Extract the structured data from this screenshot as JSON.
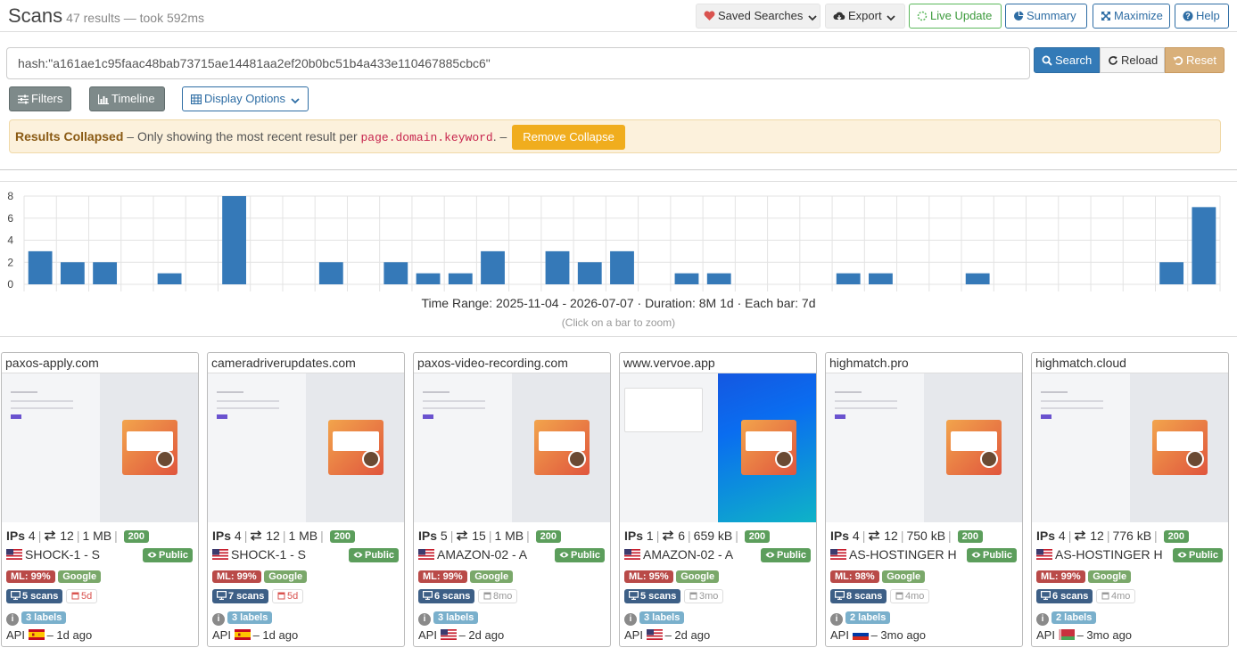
{
  "header": {
    "title": "Scans",
    "subtitle": "47 results — took 592ms",
    "buttons": {
      "saved": "Saved Searches",
      "export": "Export",
      "live": "Live Update",
      "summary": "Summary",
      "maximize": "Maximize",
      "help": "Help"
    }
  },
  "search": {
    "query": "hash:\"a161ae1c95faac48bab73715ae14481aa2ef20b0bc51b4a433e110467885cbc6\"",
    "search_label": "Search",
    "reload_label": "Reload",
    "reset_label": "Reset"
  },
  "toolbar": {
    "filters": "Filters",
    "timeline": "Timeline",
    "display": "Display Options"
  },
  "alert": {
    "title": "Results Collapsed",
    "text_before": "– Only showing the most recent result per",
    "field": "page.domain.keyword",
    "text_after": ". –",
    "button": "Remove Collapse"
  },
  "chart_data": {
    "type": "bar",
    "yticks": [
      0,
      2,
      4,
      6,
      8
    ],
    "ylim": [
      0,
      8
    ],
    "values": [
      3,
      2,
      2,
      0,
      1,
      0,
      8,
      0,
      0,
      2,
      0,
      2,
      1,
      1,
      3,
      0,
      3,
      2,
      3,
      0,
      1,
      1,
      0,
      0,
      0,
      1,
      1,
      0,
      0,
      1,
      0,
      0,
      0,
      0,
      0,
      2,
      7
    ],
    "caption": "Time Range: 2025-11-04 - 2026-07-07 · Duration: 8M 1d · Each bar: 7d",
    "hint": "(Click on a bar to zoom)",
    "colors": {
      "bar": "#3579b8",
      "grid": "#e3e3e3"
    }
  },
  "cards": [
    {
      "domain": "paxos-apply.com",
      "ips": "4",
      "redirects": "12",
      "size": "1 MB",
      "status": "200",
      "asn": "SHOCK-1 - S",
      "flag": "us",
      "visibility": "Public",
      "ml": "ML: 99%",
      "brand": "Google",
      "scans": "5 scans",
      "age": "5d",
      "age_color": "red",
      "labels": "3 labels",
      "source": "API",
      "src_flag": "es",
      "ago": "– 1d ago",
      "thumb": "default"
    },
    {
      "domain": "cameradriverupdates.com",
      "ips": "4",
      "redirects": "12",
      "size": "1 MB",
      "status": "200",
      "asn": "SHOCK-1 - S",
      "flag": "us",
      "visibility": "Public",
      "ml": "ML: 99%",
      "brand": "Google",
      "scans": "7 scans",
      "age": "5d",
      "age_color": "red",
      "labels": "3 labels",
      "source": "API",
      "src_flag": "es",
      "ago": "– 1d ago",
      "thumb": "default"
    },
    {
      "domain": "paxos-video-recording.com",
      "ips": "5",
      "redirects": "15",
      "size": "1 MB",
      "status": "200",
      "asn": "AMAZON-02 - A",
      "flag": "us",
      "visibility": "Public",
      "ml": "ML: 99%",
      "brand": "Google",
      "scans": "6 scans",
      "age": "8mo",
      "age_color": "gray",
      "labels": "3 labels",
      "source": "API",
      "src_flag": "us",
      "ago": "– 2d ago",
      "thumb": "default"
    },
    {
      "domain": "www.vervoe.app",
      "ips": "1",
      "redirects": "6",
      "size": "659 kB",
      "status": "200",
      "asn": "AMAZON-02 - A",
      "flag": "us",
      "visibility": "Public",
      "ml": "ML: 95%",
      "brand": "Google",
      "scans": "5 scans",
      "age": "3mo",
      "age_color": "gray",
      "labels": "3 labels",
      "source": "API",
      "src_flag": "us",
      "ago": "– 2d ago",
      "thumb": "vervoe"
    },
    {
      "domain": "highmatch.pro",
      "ips": "4",
      "redirects": "12",
      "size": "750 kB",
      "status": "200",
      "asn": "AS-HOSTINGER H",
      "flag": "us",
      "visibility": "Public",
      "ml": "ML: 98%",
      "brand": "Google",
      "scans": "8 scans",
      "age": "4mo",
      "age_color": "gray",
      "labels": "2 labels",
      "source": "API",
      "src_flag": "ru",
      "ago": "– 3mo ago",
      "thumb": "default"
    },
    {
      "domain": "highmatch.cloud",
      "ips": "4",
      "redirects": "12",
      "size": "776 kB",
      "status": "200",
      "asn": "AS-HOSTINGER H",
      "flag": "us",
      "visibility": "Public",
      "ml": "ML: 99%",
      "brand": "Google",
      "scans": "6 scans",
      "age": "4mo",
      "age_color": "gray",
      "labels": "2 labels",
      "source": "API",
      "src_flag": "by",
      "ago": "– 3mo ago",
      "thumb": "default"
    }
  ],
  "labels": {
    "ips": "IPs"
  }
}
